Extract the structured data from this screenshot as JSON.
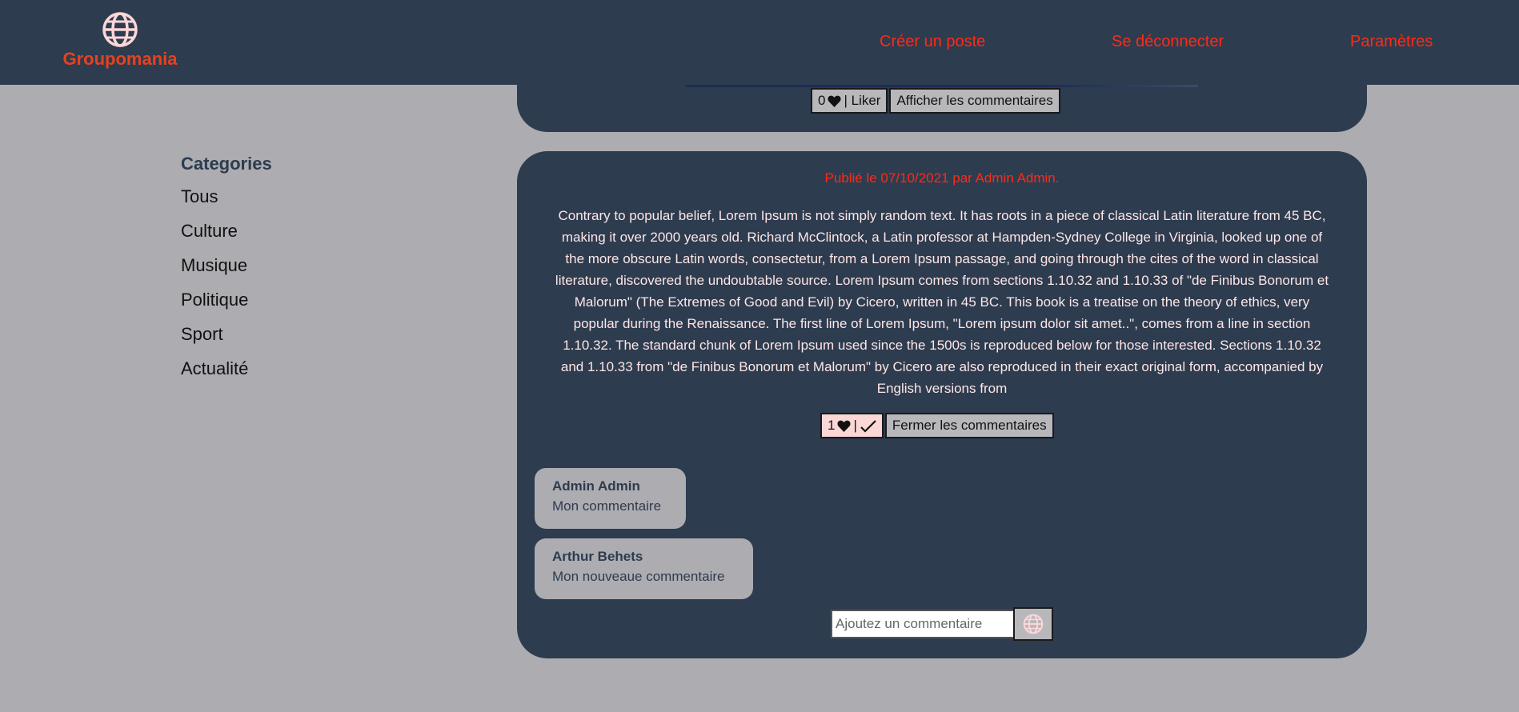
{
  "colors": {
    "header_bg": "#2d3c4f",
    "page_bg": "#adacb1",
    "nav_link": "#ff2a17",
    "logo": "#e8411e",
    "post_text": "#ffe6e6",
    "liked_button": "#fcd7d7"
  },
  "header": {
    "logo_text": "Groupomania",
    "logo_icon": "globe-icon",
    "nav": {
      "create_post": "Créer un poste",
      "logout": "Se déconnecter",
      "settings": "Paramètres"
    }
  },
  "sidebar": {
    "title": "Categories",
    "items": [
      "Tous",
      "Culture",
      "Musique",
      "Politique",
      "Sport",
      "Actualité"
    ]
  },
  "previous_post": {
    "like_count": "0",
    "like_label": "| Liker",
    "show_comments": "Afficher les commentaires"
  },
  "post": {
    "meta": "Publié le 07/10/2021 par Admin Admin.",
    "body": "Contrary to popular belief, Lorem Ipsum is not simply random text. It has roots in a piece of classical Latin literature from 45 BC, making it over 2000 years old. Richard McClintock, a Latin professor at Hampden-Sydney College in Virginia, looked up one of the more obscure Latin words, consectetur, from a Lorem Ipsum passage, and going through the cites of the word in classical literature, discovered the undoubtable source. Lorem Ipsum comes from sections 1.10.32 and 1.10.33 of \"de Finibus Bonorum et Malorum\" (The Extremes of Good and Evil) by Cicero, written in 45 BC. This book is a treatise on the theory of ethics, very popular during the Renaissance. The first line of Lorem Ipsum, \"Lorem ipsum dolor sit amet..\", comes from a line in section 1.10.32. The standard chunk of Lorem Ipsum used since the 1500s is reproduced below for those interested. Sections 1.10.32 and 1.10.33 from \"de Finibus Bonorum et Malorum\" by Cicero are also reproduced in their exact original form, accompanied by English versions from",
    "like_count": "1",
    "like_separator": "|",
    "liked": true,
    "close_comments": "Fermer les commentaires",
    "comments": [
      {
        "author": "Admin Admin",
        "text": "Mon commentaire"
      },
      {
        "author": "Arthur Behets",
        "text": "Mon nouveaue commentaire"
      }
    ],
    "comment_input": {
      "placeholder": "Ajoutez un commentaire",
      "value": ""
    },
    "send_icon": "globe-icon"
  }
}
